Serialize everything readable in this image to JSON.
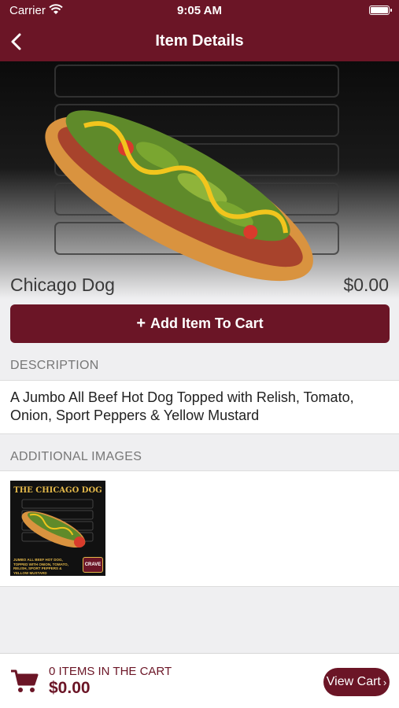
{
  "status_bar": {
    "carrier": "Carrier",
    "time": "9:05 AM"
  },
  "nav": {
    "title": "Item Details",
    "back_icon": "chevron-left-icon"
  },
  "item": {
    "name": "Chicago Dog",
    "price": "$0.00"
  },
  "actions": {
    "add_to_cart_label": "Add Item To Cart",
    "add_icon": "plus-icon"
  },
  "description": {
    "header": "DESCRIPTION",
    "text": "A Jumbo All Beef Hot Dog Topped with Relish, Tomato, Onion, Sport Peppers & Yellow Mustard"
  },
  "additional_images": {
    "header": "ADDITIONAL IMAGES",
    "thumbnails": [
      {
        "title": "THE CHICAGO DOG",
        "caption": "JUMBO ALL BEEF HOT DOG, TOPPED WITH ONION, TOMATO, RELISH, SPORT PEPPERS & YELLOW MUSTARD",
        "logo": "CRAVE"
      }
    ]
  },
  "cart": {
    "count_label": "0 ITEMS IN THE CART",
    "total": "$0.00",
    "view_button": "View Cart",
    "icon": "shopping-cart-icon"
  },
  "colors": {
    "brand": "#6b1526",
    "background": "#efeff1",
    "mustard": "#e3b84a"
  }
}
